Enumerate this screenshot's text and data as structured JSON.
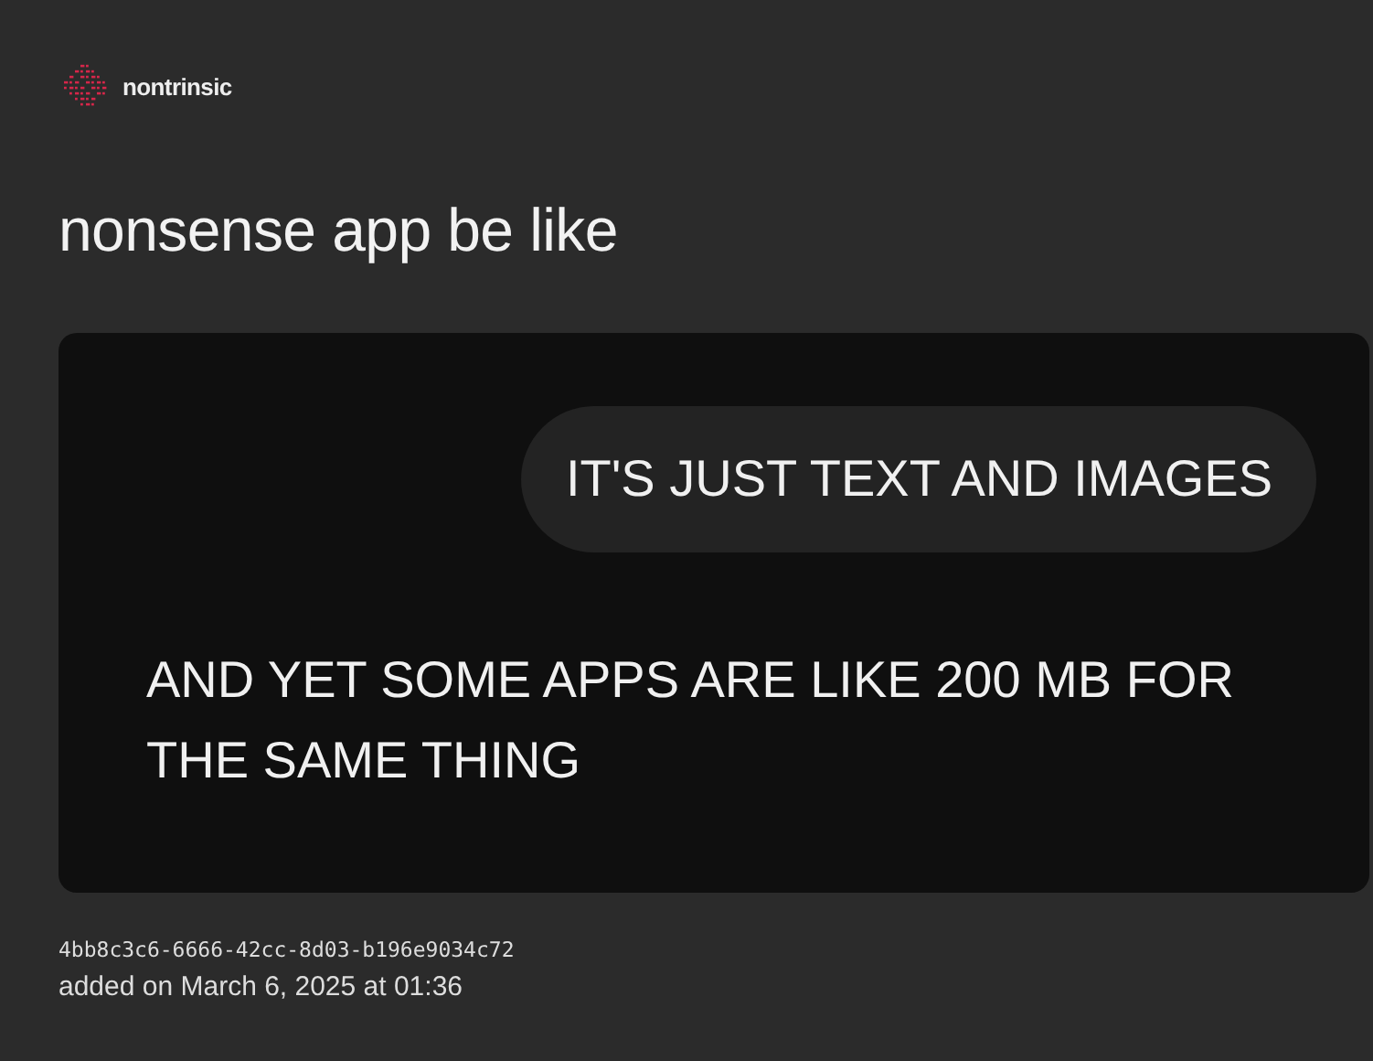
{
  "brand": {
    "name": "nontrinsic"
  },
  "post": {
    "title": "nonsense app be like",
    "image": {
      "bubble": "IT'S JUST TEXT AND IMAGES",
      "message": "AND YET SOME APPS ARE LIKE 200 MB FOR THE SAME THING"
    },
    "id": "4bb8c3c6-6666-42cc-8d03-b196e9034c72",
    "added": "added on March 6, 2025 at 01:36"
  }
}
